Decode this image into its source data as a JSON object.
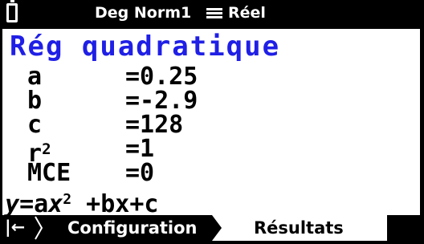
{
  "status": {
    "mode": "Deg Norm1",
    "number_format": "Réel"
  },
  "title": "Rég quadratique",
  "results": [
    {
      "name": "a",
      "value": "=0.25"
    },
    {
      "name": "b",
      "value": "=-2.9"
    },
    {
      "name": "c",
      "value": "=128"
    },
    {
      "name": "r",
      "exp": "2",
      "value": "=1"
    },
    {
      "name": "MCE",
      "value": "=0"
    }
  ],
  "formula": {
    "y": "y",
    "eq": "=a",
    "x1": "x",
    "sq": "2",
    "rest": " +bx+c"
  },
  "tabs": {
    "back_icon": "|←",
    "config_label": "Configuration",
    "results_label": "Résultats"
  },
  "colors": {
    "title": "#1f1fe6",
    "bar": "#000000"
  }
}
